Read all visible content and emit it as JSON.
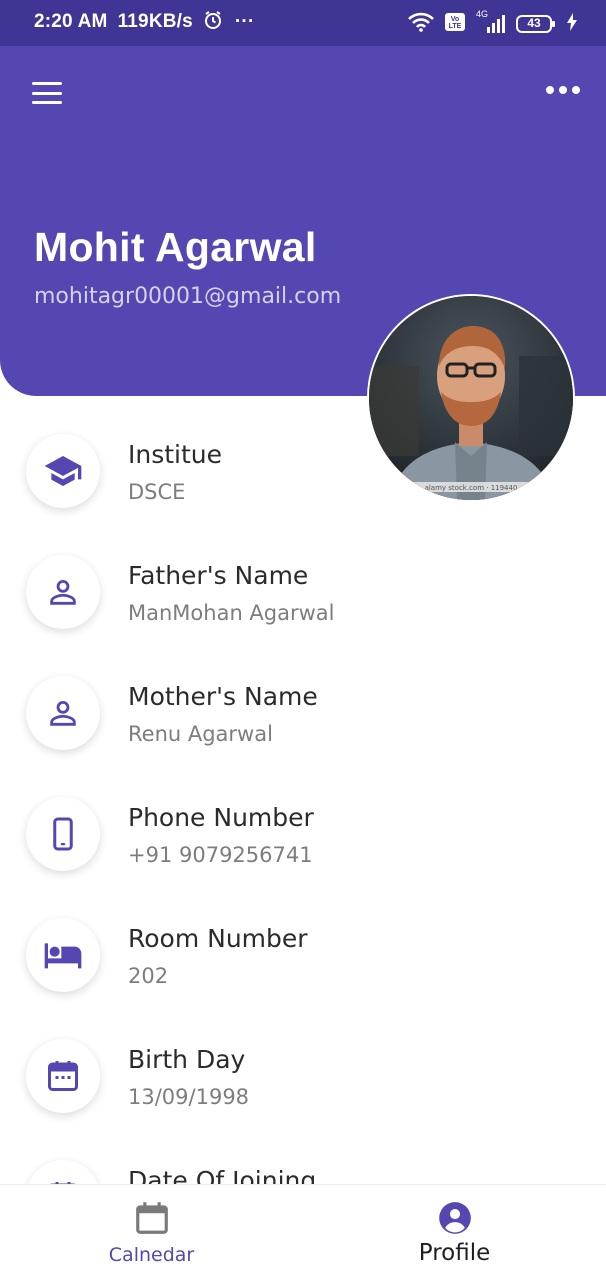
{
  "status_bar": {
    "time": "2:20 AM",
    "speed": "119KB/s",
    "more": "···",
    "network": "4G",
    "battery": "43"
  },
  "header": {
    "name": "Mohit Agarwal",
    "email": "mohitagr00001@gmail.com",
    "avatar_caption": "alamy stock.com · 119440"
  },
  "profile_fields": [
    {
      "label": "Institue",
      "value": "DSCE",
      "icon": "school-icon"
    },
    {
      "label": "Father's Name",
      "value": "ManMohan Agarwal",
      "icon": "person-icon"
    },
    {
      "label": "Mother's Name",
      "value": "Renu Agarwal",
      "icon": "person-icon"
    },
    {
      "label": "Phone Number",
      "value": "+91 9079256741",
      "icon": "phone-icon"
    },
    {
      "label": "Room Number",
      "value": "202",
      "icon": "bed-icon"
    },
    {
      "label": "Birth Day",
      "value": "13/09/1998",
      "icon": "calendar-icon"
    },
    {
      "label": "Date Of Joining",
      "value": "",
      "icon": "calendar-icon"
    }
  ],
  "bottom_nav": {
    "calendar_label": "Calnedar",
    "profile_label": "Profile"
  },
  "colors": {
    "primary": "#5547b1",
    "status_bar": "#3f3595",
    "text_dark": "#2b2b2b",
    "text_muted": "#7d7d7d"
  }
}
